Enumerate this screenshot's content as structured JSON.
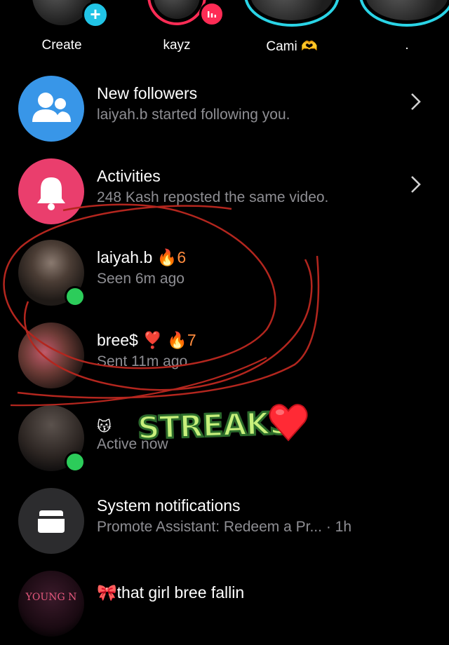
{
  "stories": [
    {
      "label": "Create",
      "badge": "+",
      "ring": "none"
    },
    {
      "label": "kayz",
      "badge": "live",
      "ring": "#fe2c55"
    },
    {
      "label": "Cami 🫶",
      "badge": "",
      "ring": "#2ad4e6"
    },
    {
      "label": ".",
      "badge": "",
      "ring": "#2ad4e6"
    }
  ],
  "rows": [
    {
      "title": "New followers",
      "subtitle": "laiyah.b started following you.",
      "icon": "people-icon",
      "icon_bg": "#3896e8"
    },
    {
      "title": "Activities",
      "subtitle": "248  Kash reposted the same video.",
      "icon": "bell-icon",
      "icon_bg": "#ea3e6d"
    },
    {
      "name": "laiyah.b",
      "streak_flame": "🔥",
      "streak": "6",
      "subtitle": "Seen 6m ago",
      "online": true
    },
    {
      "name": "bree$",
      "name_emoji": "❣️",
      "streak_flame": "🔥",
      "streak": "7",
      "subtitle": "Sent 11m ago",
      "online": false
    },
    {
      "name_emoji": "😽",
      "subtitle": "Active now",
      "online": true
    },
    {
      "title": "System notifications",
      "subtitle": "Promote Assistant: Redeem a Pr...",
      "time": "· 1h",
      "icon": "inbox-icon",
      "icon_bg": "#2c2c2e"
    },
    {
      "name_emoji": "🎀",
      "title": "that girl bree fallin",
      "avatar_text": "YOUNG N"
    }
  ],
  "sticker": {
    "text": "STREAKS",
    "heart": "❤️"
  },
  "colors": {
    "background": "#000000",
    "secondary_text": "#8e8e93",
    "online": "#2ccc5a",
    "annotation": "#b3261e"
  }
}
